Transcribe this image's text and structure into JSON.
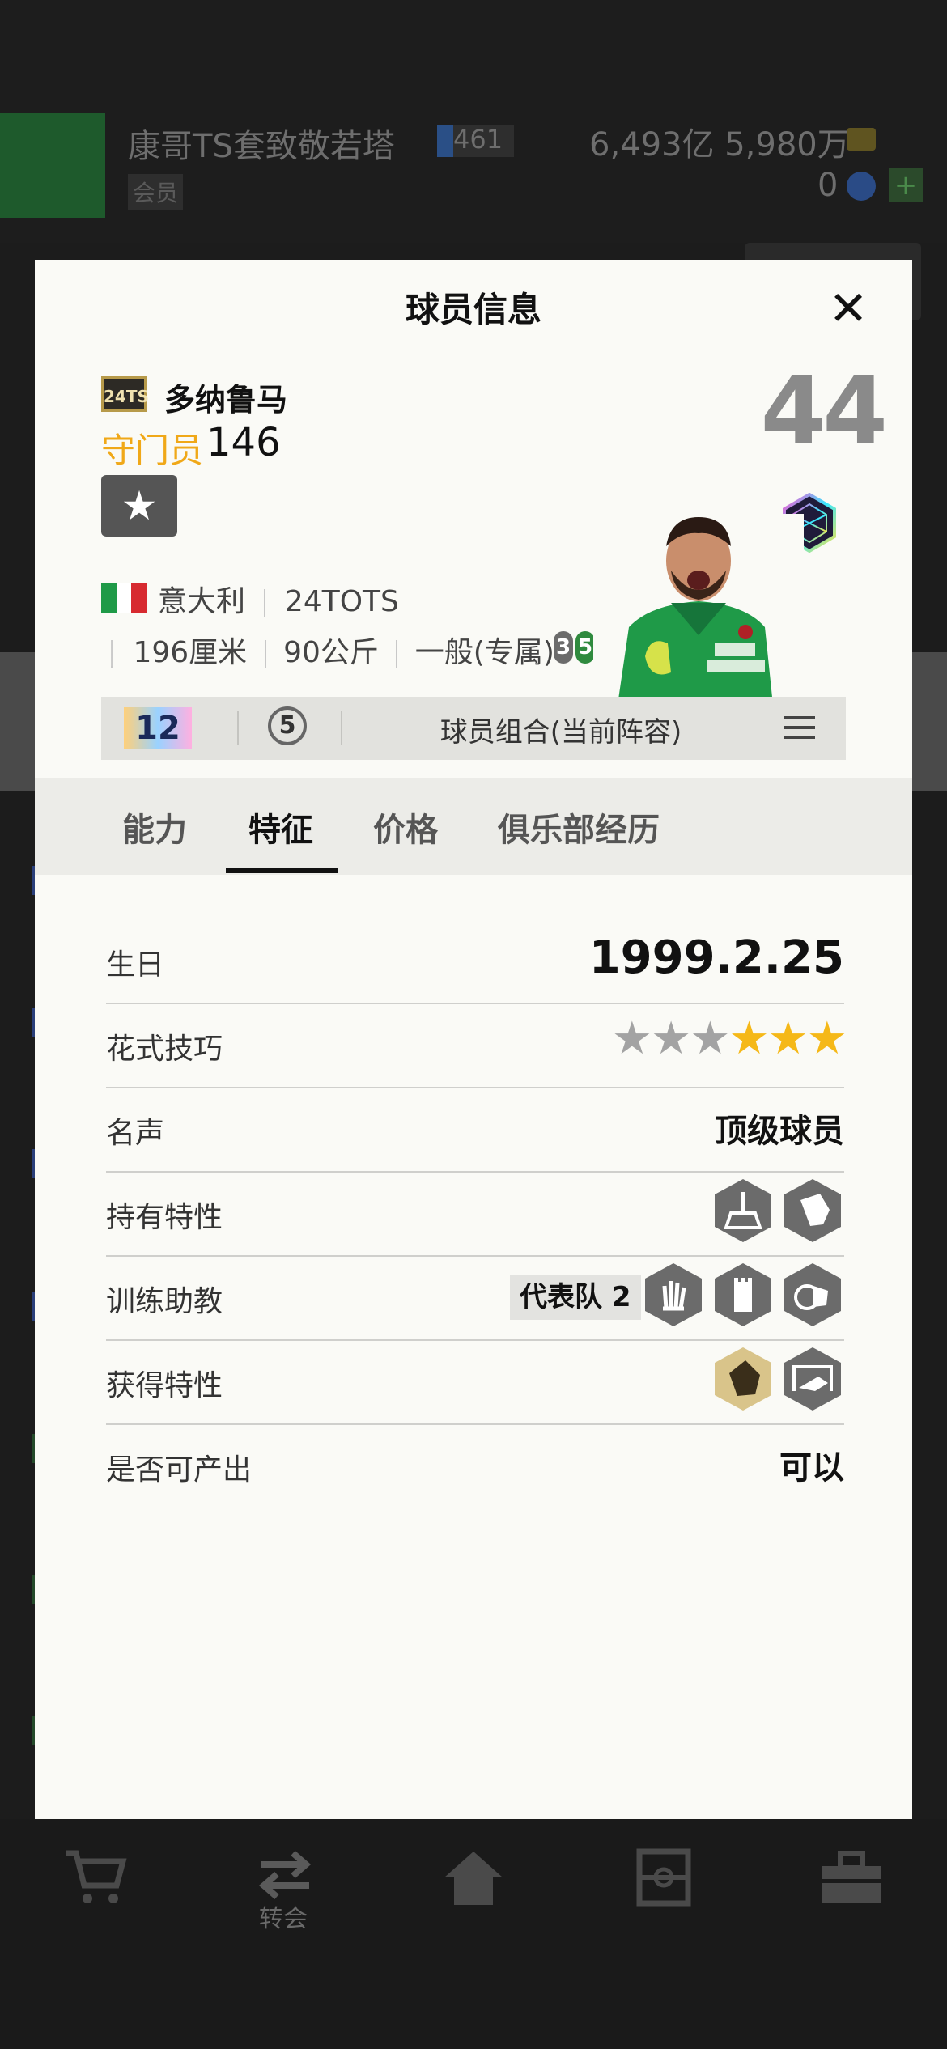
{
  "background": {
    "team_name": "康哥TS套致敬若塔",
    "team_level": "461",
    "member_tag": "会员",
    "money": "6,493亿 5,980万",
    "coins": "0",
    "plus": "+",
    "nav_label": "转会"
  },
  "modal": {
    "title": "球员信息",
    "close": "✕"
  },
  "player": {
    "season": "24TS",
    "name": "多纳鲁马",
    "position": "守门员",
    "ovr_small": "146",
    "ovr_big": "44",
    "star": "★",
    "nation": "意大利",
    "season_name": "24TOTS",
    "height": "196厘米",
    "weight": "90公斤",
    "body_type": "一般(专属)",
    "foot_left": "3",
    "foot_right": "5"
  },
  "combo": {
    "level": "12",
    "count": "5",
    "label": "球员组合(当前阵容)"
  },
  "tabs": [
    "能力",
    "特征",
    "价格",
    "俱乐部经历"
  ],
  "active_tab": "特征",
  "rows": {
    "birthday_label": "生日",
    "birthday": "1999.2.25",
    "skill_label": "花式技巧",
    "skill_stars": 3,
    "skill_max": 6,
    "fame_label": "名声",
    "fame": "顶级球员",
    "traits_label": "持有特性",
    "coach_label": "训练助教",
    "coach_tag": "代表队 2",
    "acquired_label": "获得特性",
    "tradable_label": "是否可产出",
    "tradable": "可以"
  },
  "colors": {
    "position": "#f0a818",
    "star_on": "#f5b818",
    "star_off": "#a3a3a3",
    "hex_gray": "#6b6b6b",
    "hex_gold": "#d9c48a"
  },
  "icons": [
    "close-icon",
    "star-icon",
    "class-icon",
    "menu-icon",
    "cart-icon",
    "transfer-icon",
    "home-icon",
    "formation-icon",
    "toolbox-icon"
  ]
}
